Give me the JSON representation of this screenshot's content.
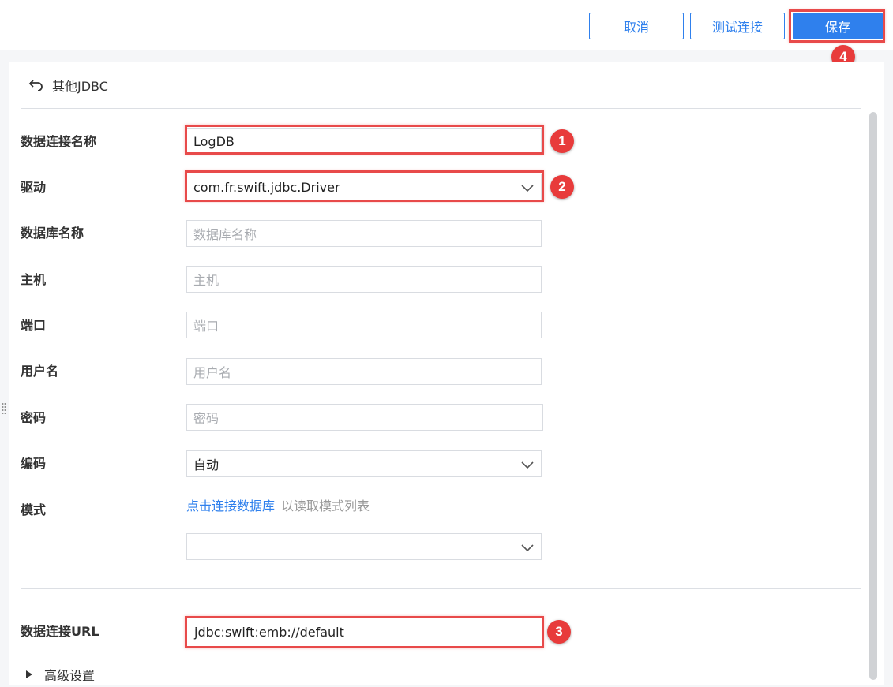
{
  "toolbar": {
    "cancel_label": "取消",
    "test_label": "测试连接",
    "save_label": "保存"
  },
  "header": {
    "back_label": "其他JDBC"
  },
  "form": {
    "connection_name": {
      "label": "数据连接名称",
      "value": "LogDB"
    },
    "driver": {
      "label": "驱动",
      "value": "com.fr.swift.jdbc.Driver"
    },
    "database": {
      "label": "数据库名称",
      "placeholder": "数据库名称"
    },
    "host": {
      "label": "主机",
      "placeholder": "主机"
    },
    "port": {
      "label": "端口",
      "placeholder": "端口"
    },
    "username": {
      "label": "用户名",
      "placeholder": "用户名"
    },
    "password": {
      "label": "密码",
      "placeholder": "密码"
    },
    "encoding": {
      "label": "编码",
      "value": "自动"
    },
    "mode": {
      "label": "模式",
      "link_text": "点击连接数据库",
      "hint": "以读取模式列表",
      "value": ""
    },
    "url": {
      "label": "数据连接URL",
      "value": "jdbc:swift:emb://default"
    }
  },
  "advanced_label": "高级设置",
  "annotations": {
    "n1": "1",
    "n2": "2",
    "n3": "3",
    "n4": "4"
  },
  "colors": {
    "accent": "#2f80ed",
    "highlight": "#e84a4a",
    "badge": "#e83b3b"
  },
  "icons": [
    "undo-arrow-icon",
    "chevron-down-icon",
    "caret-right-icon",
    "drag-handle-icon"
  ]
}
